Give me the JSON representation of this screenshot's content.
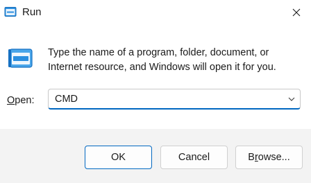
{
  "window": {
    "title": "Run",
    "title_icon": "run-icon",
    "close_icon": "close-icon"
  },
  "main": {
    "icon": "run-dialog-icon",
    "message_line1": "Type the name of a program, folder, document, or",
    "message_line2": "Internet resource, and Windows will open it for you.",
    "open_label_hotkey": "O",
    "open_label_rest": "pen:",
    "open_value": "CMD",
    "dropdown_icon": "chevron-down-icon"
  },
  "footer": {
    "ok_label": "OK",
    "cancel_label": "Cancel",
    "browse_label_prefix": "B",
    "browse_label_hotkey": "r",
    "browse_label_rest": "owse..."
  },
  "colors": {
    "accent": "#0067c0",
    "footer_bg": "#f3f3f3",
    "icon_blue": "#1e88d8"
  }
}
